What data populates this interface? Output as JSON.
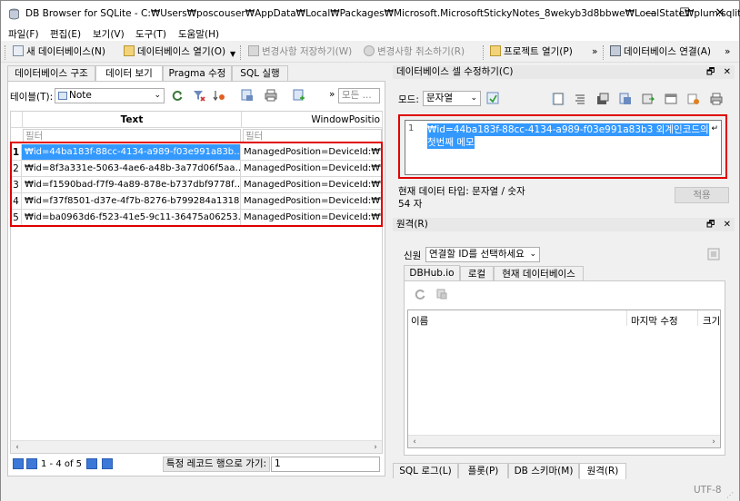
{
  "window": {
    "title": "DB Browser for SQLite - C:₩Users₩poscouser₩AppData₩Local₩Packages₩Microsoft.MicrosoftStickyNotes_8wekyb3d8bbwe₩LocalState₩plum.sqlite",
    "minimize": "—",
    "maximize": "☐",
    "close": "✕"
  },
  "menu": [
    "파일(F)",
    "편집(E)",
    "보기(V)",
    "도구(T)",
    "도움말(H)"
  ],
  "toolbar": {
    "new_db": "새 데이터베이스(N)",
    "open_db": "데이터베이스 열기(O)",
    "write_changes": "변경사항 저장하기(W)",
    "revert_changes": "변경사항 취소하기(R)",
    "open_project": "프로젝트 열기(P)",
    "attach_db": "데이터베이스 연결(A)",
    "overflow": "»"
  },
  "left_tabs": [
    "데이터베이스 구조",
    "데이터 보기",
    "Pragma 수정",
    "SQL 실행"
  ],
  "browse": {
    "table_label": "테이블(T):",
    "table_value": "Note",
    "filter_all_placeholder": "모든 ...",
    "overflow": "»",
    "columns": [
      "Text",
      "WindowPositio"
    ],
    "filter_placeholder": "필터",
    "rows": [
      {
        "n": "1",
        "text": "₩id=44ba183f-88cc-4134-a989-f03e991a83b…",
        "pos": "ManagedPosition=DeviceId:₩₩"
      },
      {
        "n": "2",
        "text": "₩id=8f3a331e-5063-4ae6-a48b-3a77d06f5aa…",
        "pos": "ManagedPosition=DeviceId:₩₩"
      },
      {
        "n": "3",
        "text": "₩id=f1590bad-f7f9-4a89-878e-b737dbf9778f…",
        "pos": "ManagedPosition=DeviceId:₩₩"
      },
      {
        "n": "4",
        "text": "₩id=f37f8501-d37e-4f7b-8276-b799284a1318…",
        "pos": "ManagedPosition=DeviceId:₩₩"
      },
      {
        "n": "5",
        "text": "₩id=ba0963d6-f523-41e5-9c11-36475a06253…",
        "pos": "ManagedPosition=DeviceId:₩₩"
      }
    ],
    "record_info": "1 - 4 of 5",
    "goto_label": "특정 레코드 행으로 가기:",
    "goto_value": "1"
  },
  "edit_cell": {
    "panel_title": "데이터베이스 셀 수정하기(C)",
    "mode_label": "모드:",
    "mode_value": "문자열",
    "line_no": "1",
    "content_line1": "₩id=44ba183f-88cc-4134-a989-f03e991a83b3 외계인코드의",
    "content_line2": "첫번째 메모",
    "type_info": "현재 데이터 타입: 문자열 / 숫자",
    "size_info": "54 자",
    "apply": "적용"
  },
  "remote": {
    "panel_title": "원격(R)",
    "identity_label": "신원",
    "identity_value": "연결할 ID를 선택하세요",
    "tabs": [
      "DBHub.io",
      "로컬",
      "현재 데이터베이스"
    ],
    "columns": [
      "이름",
      "마지막 수정",
      "크기"
    ]
  },
  "bottom_tabs": [
    "SQL 로그(L)",
    "플롯(P)",
    "DB 스키마(M)",
    "원격(R)"
  ],
  "status": {
    "encoding": "UTF-8"
  },
  "panel_controls": {
    "float": "🗗",
    "close": "✕"
  }
}
